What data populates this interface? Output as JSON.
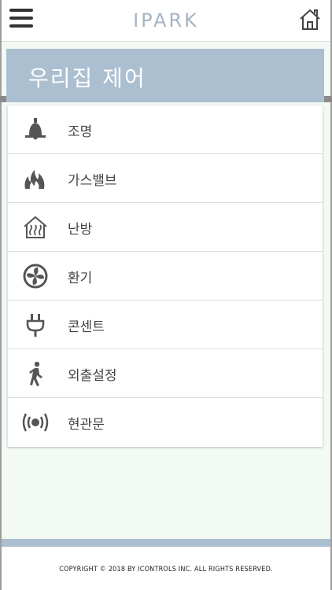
{
  "header": {
    "brand": "IPARK"
  },
  "banner": {
    "title": "우리집 제어"
  },
  "menu": {
    "items": [
      {
        "label": "조명",
        "icon": "bell-lamp-icon"
      },
      {
        "label": "가스밸브",
        "icon": "flame-icon"
      },
      {
        "label": "난방",
        "icon": "heating-house-icon"
      },
      {
        "label": "환기",
        "icon": "fan-icon"
      },
      {
        "label": "콘센트",
        "icon": "plug-icon"
      },
      {
        "label": "외출설정",
        "icon": "walking-person-icon"
      },
      {
        "label": "현관문",
        "icon": "signal-broadcast-icon"
      }
    ]
  },
  "footer": {
    "copyright": "COPYRIGHT © 2018 BY ICONTROLS INC. ALL RIGHTS RESERVED."
  },
  "colors": {
    "banner": "#acbfd1",
    "brand": "#a6b4c3",
    "icon": "#555555"
  }
}
